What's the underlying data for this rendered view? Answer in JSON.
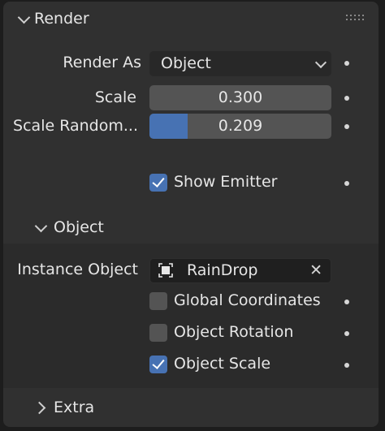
{
  "render_panel": {
    "title": "Render",
    "render_as": {
      "label": "Render As",
      "value": "Object"
    },
    "scale": {
      "label": "Scale",
      "value": "0.300"
    },
    "scale_randomness": {
      "label": "Scale Random...",
      "value": "0.209",
      "fraction": 0.209
    },
    "show_emitter": {
      "label": "Show Emitter",
      "checked": true
    }
  },
  "object_subpanel": {
    "title": "Object",
    "instance_object": {
      "label": "Instance Object",
      "value": "RainDrop"
    },
    "global_coordinates": {
      "label": "Global Coordinates",
      "checked": false
    },
    "object_rotation": {
      "label": "Object Rotation",
      "checked": false
    },
    "object_scale": {
      "label": "Object Scale",
      "checked": true
    }
  },
  "extra_subpanel": {
    "title": "Extra"
  },
  "colors": {
    "accent": "#4772b3",
    "panel_bg": "#303030",
    "field_bg": "#545454"
  },
  "icons": [
    "chevron-down-icon",
    "drag-grip-icon",
    "object-icon",
    "clear-x-icon",
    "chevron-right-icon"
  ]
}
